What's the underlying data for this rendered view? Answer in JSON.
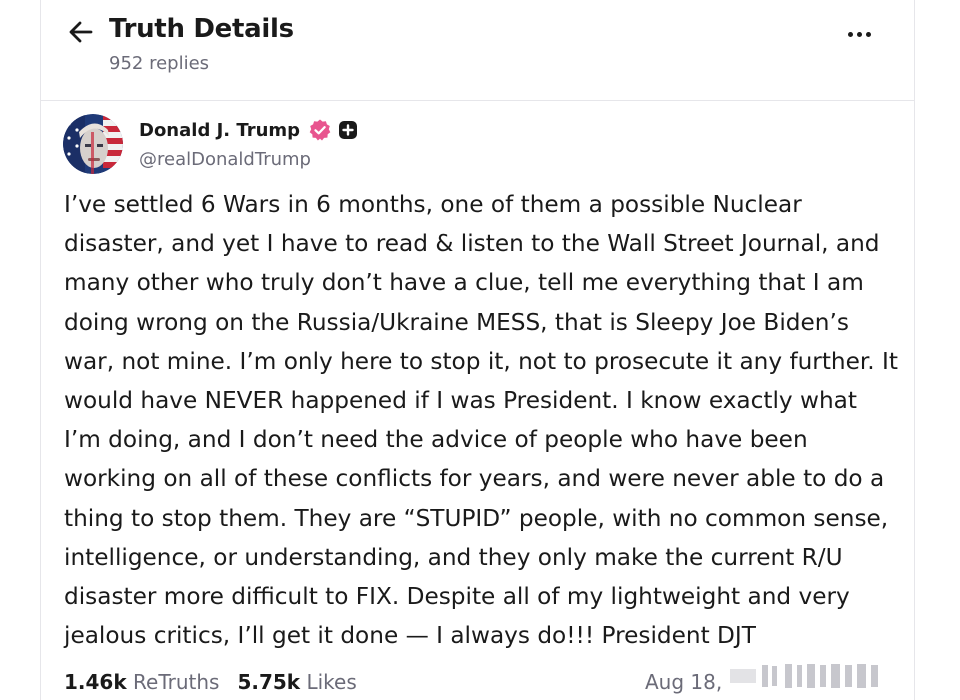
{
  "header": {
    "title": "Truth Details",
    "replies": "952 replies"
  },
  "post": {
    "author_name": "Donald J. Trump",
    "handle": "@realDonaldTrump",
    "body": "I’ve settled 6 Wars in 6 months, one of them a possible Nuclear disaster, and yet I have to read & listen to the Wall Street Journal, and many other who truly don’t have a clue, tell me everything that I am doing wrong on the Russia/Ukraine MESS, that is Sleepy Joe Biden’s war, not mine. I’m only here to stop it, not to prosecute it any further. It would have NEVER happened if I was President. I know exactly what I’m doing, and I don’t need the advice of people who have been working on all of these conflicts for years, and were never able to do a thing to stop them. They are “STUPID” people, with no common sense, intelligence, or understanding, and they only make the current R/U disaster more difficult to FIX. Despite all of my lightweight and very jealous critics, I’ll get it done — I always do!!! President DJT",
    "retruths_count": "1.46k",
    "retruths_label": "ReTruths",
    "likes_count": "5.75k",
    "likes_label": "Likes",
    "date": "Aug 18,"
  },
  "icons": {
    "back": "arrow-left-icon",
    "more": "more-horizontal-icon",
    "verified": "verified-badge-icon",
    "plus": "plus-badge-icon"
  },
  "colors": {
    "verified": "#e8558f",
    "text_primary": "#1a1a1a",
    "text_secondary": "#6b6b78"
  }
}
